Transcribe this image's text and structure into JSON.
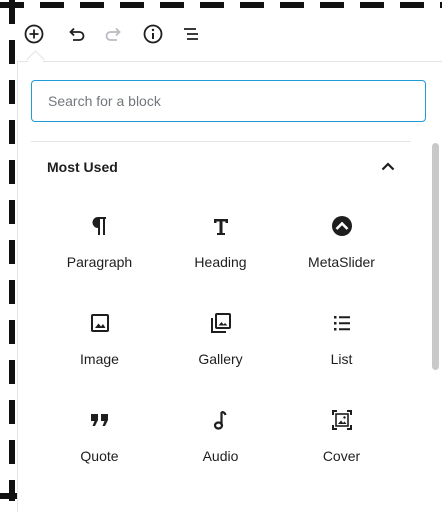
{
  "toolbar": {
    "icons": [
      "add-block-icon",
      "undo-icon",
      "redo-icon",
      "info-icon",
      "block-navigation-icon"
    ]
  },
  "search": {
    "placeholder": "Search for a block",
    "value": ""
  },
  "panel": {
    "title": "Most Used",
    "blocks": [
      {
        "label": "Paragraph",
        "icon": "paragraph-icon"
      },
      {
        "label": "Heading",
        "icon": "heading-icon"
      },
      {
        "label": "MetaSlider",
        "icon": "metaslider-icon"
      },
      {
        "label": "Image",
        "icon": "image-icon"
      },
      {
        "label": "Gallery",
        "icon": "gallery-icon"
      },
      {
        "label": "List",
        "icon": "list-icon"
      },
      {
        "label": "Quote",
        "icon": "quote-icon"
      },
      {
        "label": "Audio",
        "icon": "audio-icon"
      },
      {
        "label": "Cover",
        "icon": "cover-icon"
      }
    ]
  },
  "colors": {
    "accent": "#1f9bd6",
    "text": "#1e1e1e",
    "muted": "#72777c",
    "disabled": "#b8bcc0",
    "border": "#e2e4e7"
  }
}
